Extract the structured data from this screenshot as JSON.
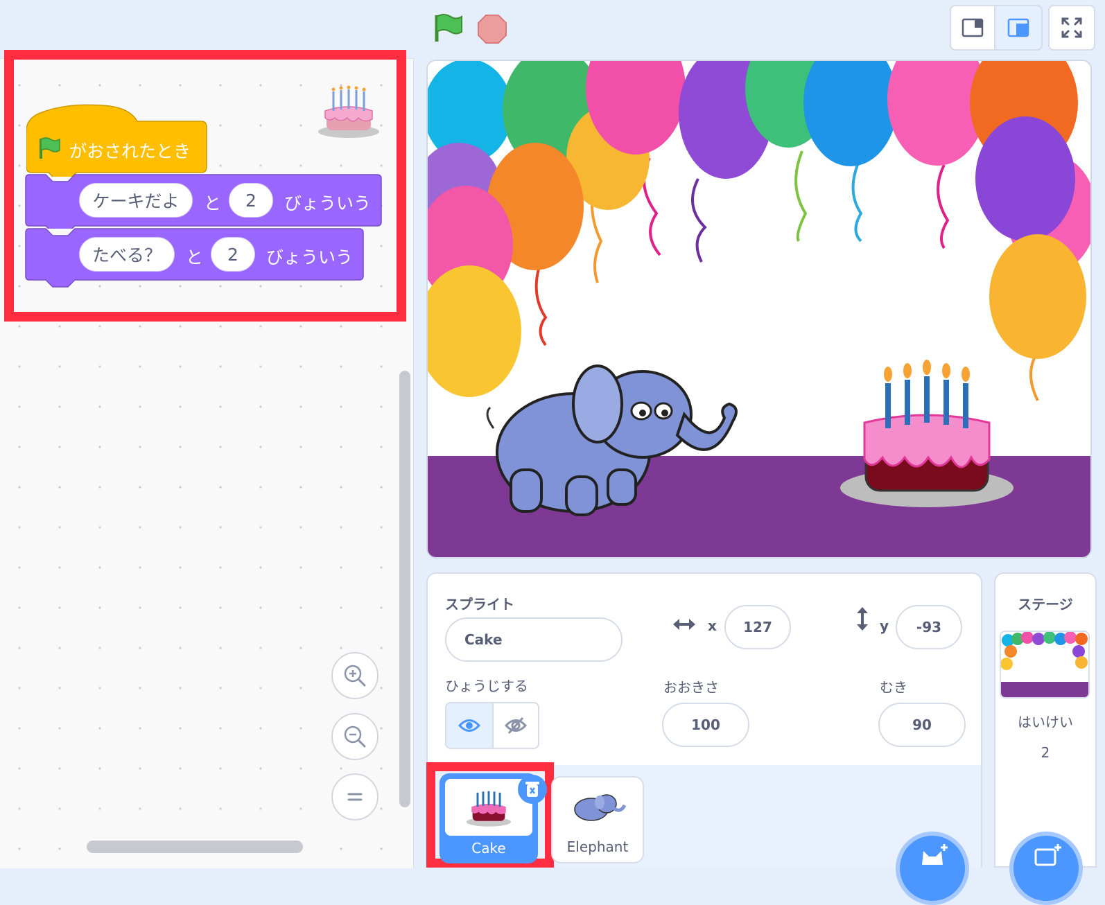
{
  "toolbar": {
    "green_flag": "green-flag-icon",
    "stop": "stop-icon",
    "layout_small": "small-stage-icon",
    "layout_large": "large-stage-icon",
    "fullscreen": "fullscreen-icon"
  },
  "code": {
    "hat_label": "がおされたとき",
    "say1": {
      "message": "ケーキだよ",
      "and": "と",
      "secs": "2",
      "verb": "びょういう"
    },
    "say2": {
      "message": "たべる？",
      "and": "と",
      "secs": "2",
      "verb": "びょういう"
    }
  },
  "sprite_info": {
    "sprite_label": "スプライト",
    "sprite_name": "Cake",
    "x_label": "x",
    "x_value": "127",
    "y_label": "y",
    "y_value": "-93",
    "show_label": "ひょうじする",
    "size_label": "おおきさ",
    "size_value": "100",
    "direction_label": "むき",
    "direction_value": "90"
  },
  "sprites": [
    {
      "name": "Cake",
      "selected": true
    },
    {
      "name": "Elephant",
      "selected": false
    }
  ],
  "stage_panel": {
    "title": "ステージ",
    "backdrop_label": "はいけい",
    "backdrop_count": "2"
  },
  "colors": {
    "event_block": "#ffbf00",
    "looks_block": "#9966ff",
    "accent": "#4c97ff",
    "highlight": "#ff2d3f"
  }
}
